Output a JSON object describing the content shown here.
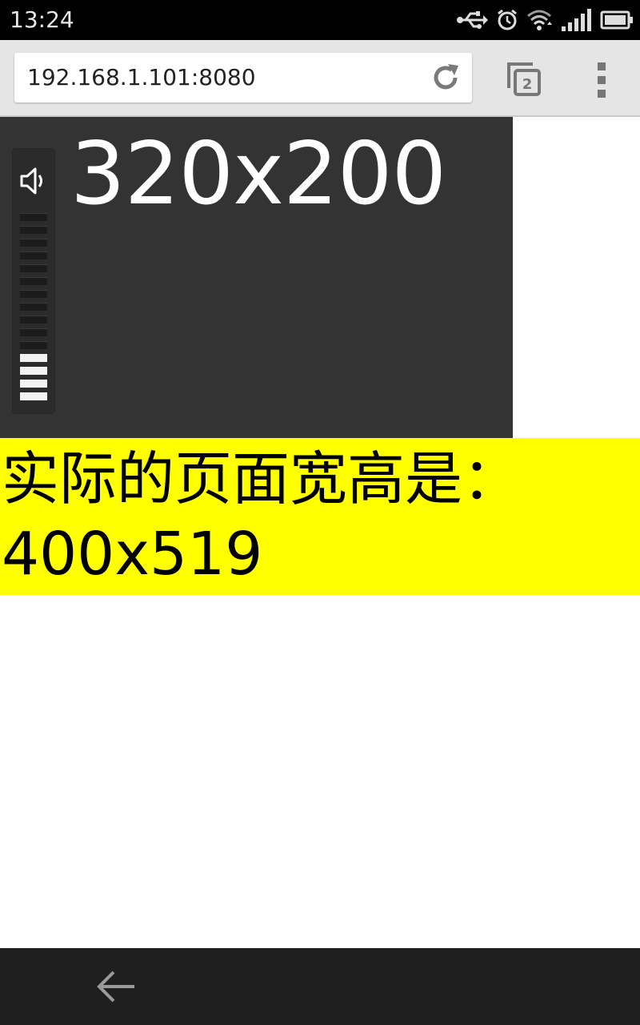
{
  "status_bar": {
    "time": "13:24",
    "icons": [
      "usb-icon",
      "alarm-icon",
      "wifi-icon",
      "signal-icon",
      "battery-icon"
    ]
  },
  "browser": {
    "url": "192.168.1.101:8080",
    "tab_count": "2",
    "icons": [
      "reload-icon",
      "tabs-icon",
      "overflow-menu-icon"
    ]
  },
  "video": {
    "size_label": "320x200",
    "volume": {
      "total_levels": 15,
      "active_levels": 4
    }
  },
  "info": {
    "label": "实际的页面宽高是：",
    "value": "400x519",
    "background": "#ffff00"
  },
  "nav": {
    "icons": [
      "back-arrow-icon"
    ]
  }
}
